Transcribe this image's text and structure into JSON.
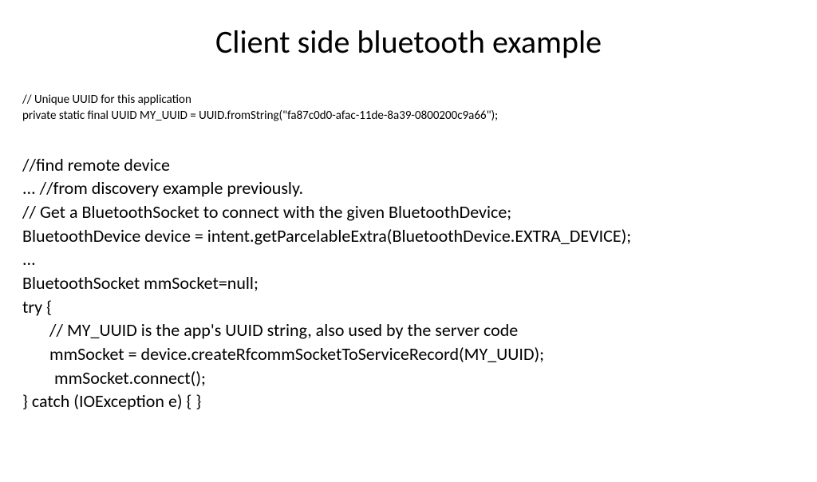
{
  "title": "Client side bluetooth example",
  "small": {
    "comment": "// Unique UUID for this application",
    "uuid_line": "private static final UUID MY_UUID = UUID.fromString(\"fa87c0d0-afac-11de-8a39-0800200c9a66\");"
  },
  "body": {
    "l1": "//find remote device",
    "l2": "...  //from discovery example previously.",
    "l3": "// Get a BluetoothSocket to connect with the given BluetoothDevice;",
    "l4": "BluetoothDevice device = intent.getParcelableExtra(BluetoothDevice.EXTRA_DEVICE);",
    "l5": "...",
    "l6": "BluetoothSocket mmSocket=null;",
    "l7": "try {",
    "l8": "// MY_UUID is the app's UUID string, also used by the server code",
    "l9": "mmSocket = device.createRfcommSocketToServiceRecord(MY_UUID);",
    "l10": "mmSocket.connect();",
    "l11": "} catch (IOException e) { }"
  }
}
